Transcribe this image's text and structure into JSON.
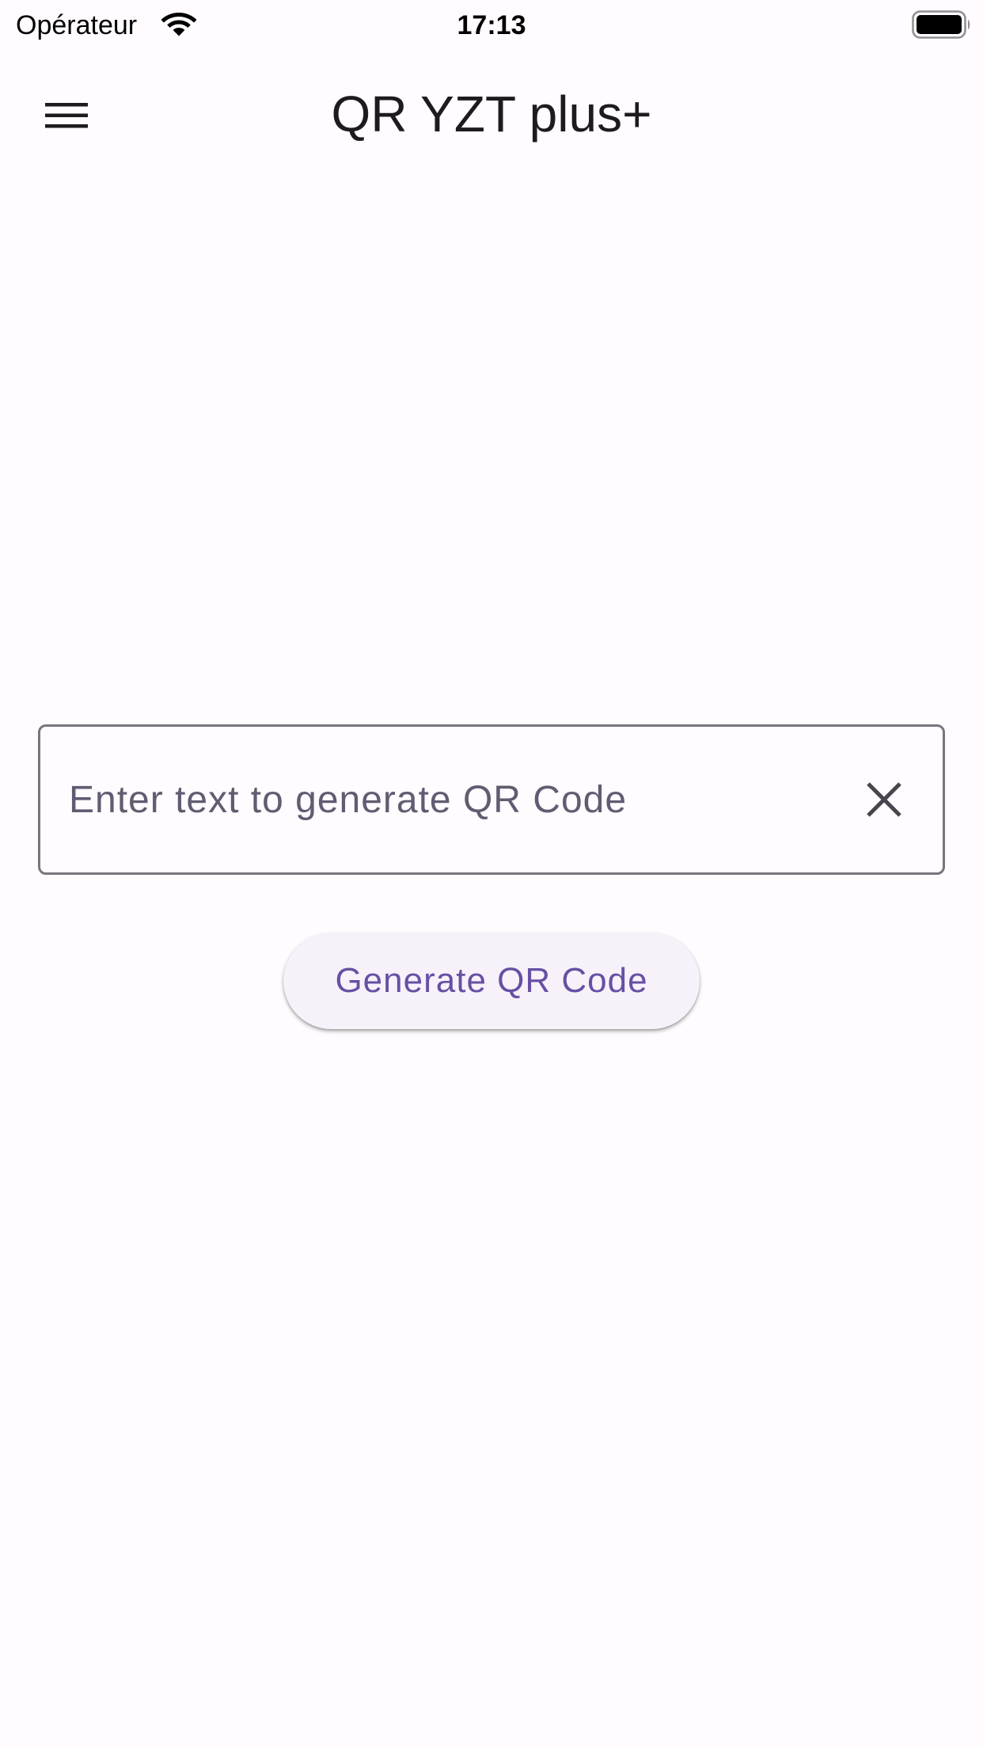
{
  "status_bar": {
    "carrier": "Opérateur",
    "time": "17:13",
    "wifi_icon": "wifi-icon",
    "battery_icon": "battery-icon"
  },
  "app_bar": {
    "menu_icon": "menu-icon",
    "title": "QR YZT plus+"
  },
  "qr_form": {
    "input_value": "",
    "input_placeholder": "Enter text to generate QR Code",
    "clear_icon": "close-icon",
    "generate_label": "Generate QR Code"
  },
  "colors": {
    "background": "#fffbfe",
    "primary": "#6750a4",
    "outline": "#79747e",
    "button_surface": "#f7f2fa",
    "on_surface": "#1d1b20"
  }
}
